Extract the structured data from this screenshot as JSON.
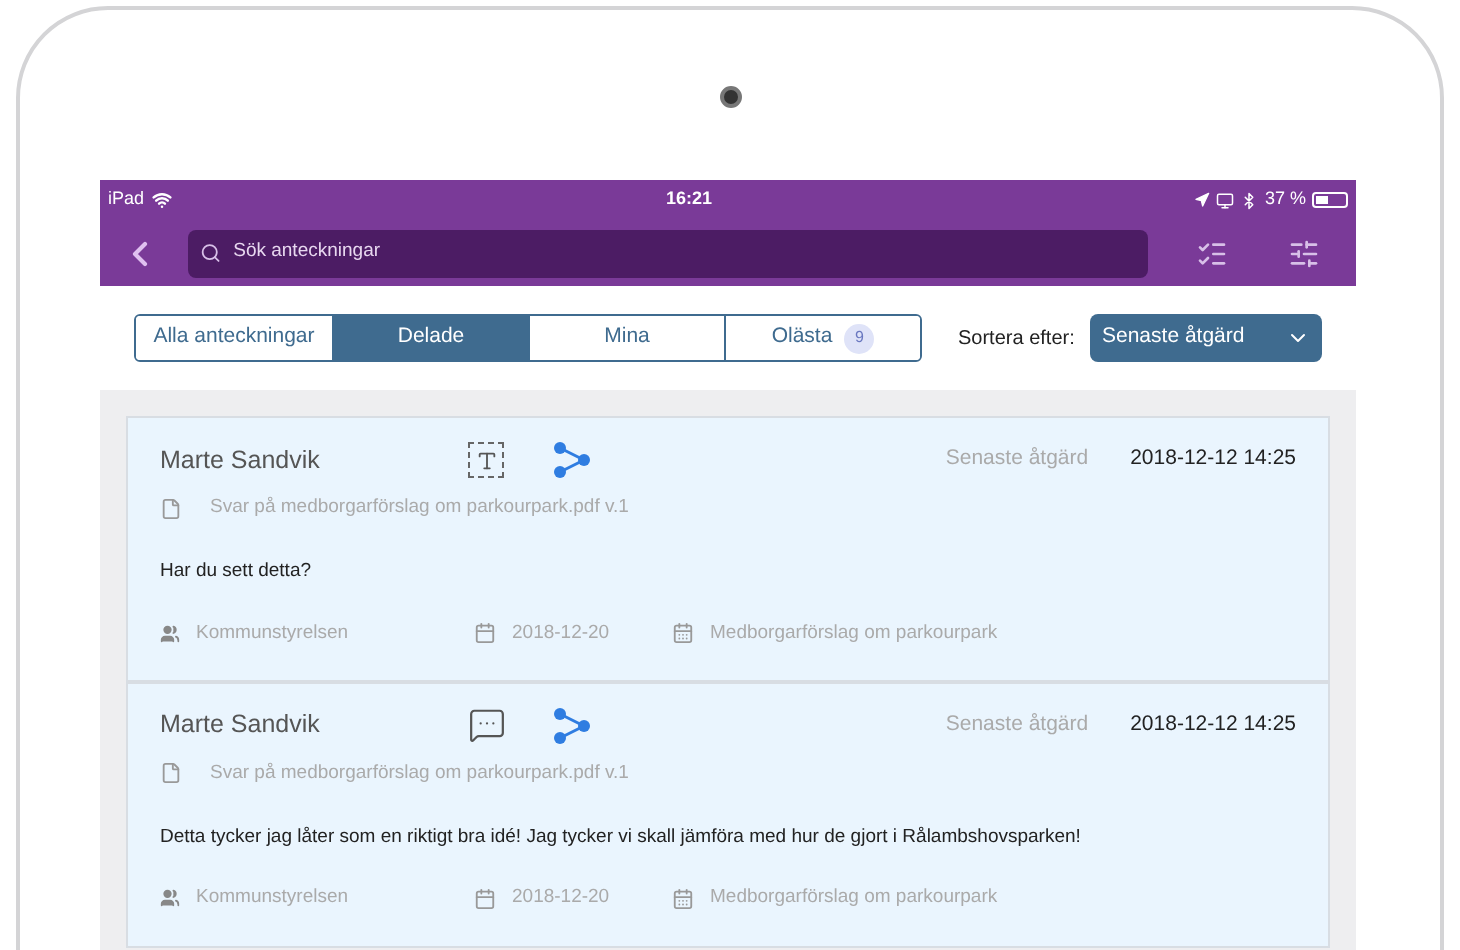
{
  "status_bar": {
    "device": "iPad",
    "time": "16:21",
    "battery": "37 %"
  },
  "search": {
    "placeholder": "Sök anteckningar"
  },
  "tabs": [
    {
      "label": "Alla anteckningar",
      "selected": false
    },
    {
      "label": "Delade",
      "selected": true
    },
    {
      "label": "Mina",
      "selected": false
    },
    {
      "label": "Olästa",
      "selected": false,
      "badge": "9"
    }
  ],
  "sort": {
    "label": "Sortera efter:",
    "value": "Senaste åtgärd"
  },
  "notes": [
    {
      "author": "Marte Sandvik",
      "kind": "text",
      "shared": true,
      "time_label": "Senaste åtgärd",
      "time": "2018-12-12 14:25",
      "document": "Svar på medborgarförslag om parkourpark.pdf v.1",
      "text": "Har du sett detta?",
      "group": "Kommunstyrelsen",
      "date": "2018-12-20",
      "meeting": "Medborgarförslag om parkourpark"
    },
    {
      "author": "Marte Sandvik",
      "kind": "comment",
      "shared": true,
      "time_label": "Senaste åtgärd",
      "time": "2018-12-12 14:25",
      "document": "Svar på medborgarförslag om parkourpark.pdf v.1",
      "text": "Detta tycker jag låter som en riktigt bra idé! Jag tycker vi skall jämföra med hur de gjort i Rålambshovsparken!",
      "group": "Kommunstyrelsen",
      "date": "2018-12-20",
      "meeting": "Medborgarförslag om parkourpark"
    }
  ]
}
